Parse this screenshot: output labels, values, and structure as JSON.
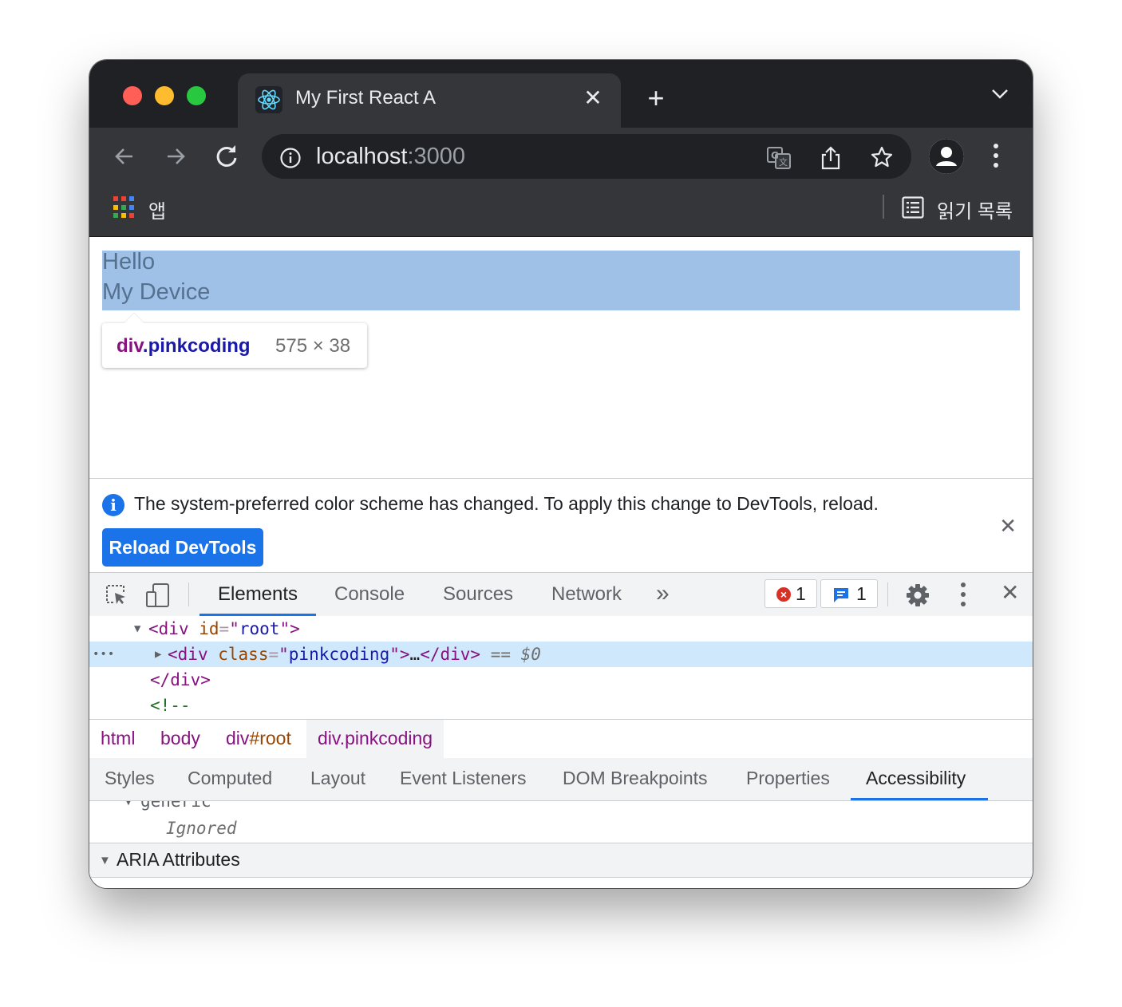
{
  "tab": {
    "title": "My First React A",
    "close": "✕"
  },
  "new_tab": "+",
  "address": {
    "host": "localhost",
    "port": ":3000"
  },
  "bookmarks": {
    "apps_label": "앱",
    "reading_list_label": "읽기 목록"
  },
  "page": {
    "line1": "Hello",
    "line2": "My Device",
    "tooltip": {
      "tag": "div",
      "class": ".pinkcoding",
      "size": "575 × 38"
    }
  },
  "infobar": {
    "message": "The system-preferred color scheme has changed. To apply this change to DevTools, reload.",
    "button": "Reload DevTools",
    "close": "✕"
  },
  "devtools": {
    "tabs": [
      "Elements",
      "Console",
      "Sources",
      "Network"
    ],
    "more": "»",
    "error_count": "1",
    "message_count": "1",
    "close": "✕"
  },
  "tree": {
    "row1": {
      "open": "<",
      "tag": "div",
      "attr": "id",
      "eq": "=",
      "q1": "\"",
      "val": "root",
      "q2": "\"",
      "close": ">"
    },
    "row2": {
      "dots": "•••",
      "open": "<",
      "tag": "div",
      "attr": "class",
      "eq": "=",
      "q1": "\"",
      "val": "pinkcoding",
      "q2": "\"",
      "close": ">",
      "ellipsis": "…",
      "end_tag": "</div>",
      "marker": "== ",
      "dollar": "$0"
    },
    "row3": "</div>",
    "row4": "<!--"
  },
  "breadcrumbs": [
    {
      "tag": "html"
    },
    {
      "tag": "body"
    },
    {
      "tag": "div",
      "id": "#root"
    },
    {
      "tag": "div.pinkcoding"
    }
  ],
  "side_tabs": [
    "Styles",
    "Computed",
    "Layout",
    "Event Listeners",
    "DOM Breakpoints",
    "Properties",
    "Accessibility"
  ],
  "accessibility": {
    "node": "generic",
    "ignored": "Ignored",
    "section": "ARIA Attributes"
  },
  "colors": {
    "accent": "#1a73e8",
    "highlight": "#9fc1e7",
    "tag": "#881280",
    "attr": "#994500",
    "value": "#1a1aa6"
  }
}
